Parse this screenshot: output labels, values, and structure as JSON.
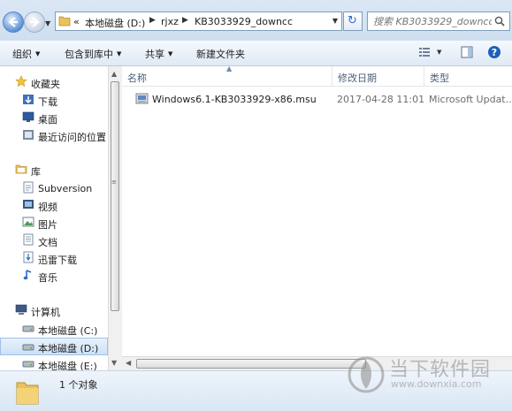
{
  "address_bar": {
    "overflow": "«",
    "crumbs": [
      "本地磁盘 (D:)",
      "rjxz",
      "KB3033929_downcc"
    ],
    "search_placeholder": "搜索 KB3033929_downcc"
  },
  "toolbar": {
    "organize": "组织",
    "include_in_library": "包含到库中",
    "share": "共享",
    "new_folder": "新建文件夹"
  },
  "nav": {
    "favorites": "收藏夹",
    "downloads": "下载",
    "desktop": "桌面",
    "recent": "最近访问的位置",
    "libraries": "库",
    "subversion": "Subversion",
    "videos": "视频",
    "pictures": "图片",
    "documents": "文档",
    "thunder": "迅雷下载",
    "music": "音乐",
    "computer": "计算机",
    "drive_c": "本地磁盘 (C:)",
    "drive_d": "本地磁盘 (D:)",
    "drive_e": "本地磁盘 (E:)"
  },
  "columns": {
    "name": "名称",
    "modified": "修改日期",
    "type": "类型"
  },
  "files": [
    {
      "name": "Windows6.1-KB3033929-x86.msu",
      "modified": "2017-04-28 11:01",
      "type": "Microsoft Updat..."
    }
  ],
  "status": {
    "count": "1 个对象"
  },
  "watermark": {
    "text": "当下软件园",
    "url": "www.downxia.com"
  }
}
